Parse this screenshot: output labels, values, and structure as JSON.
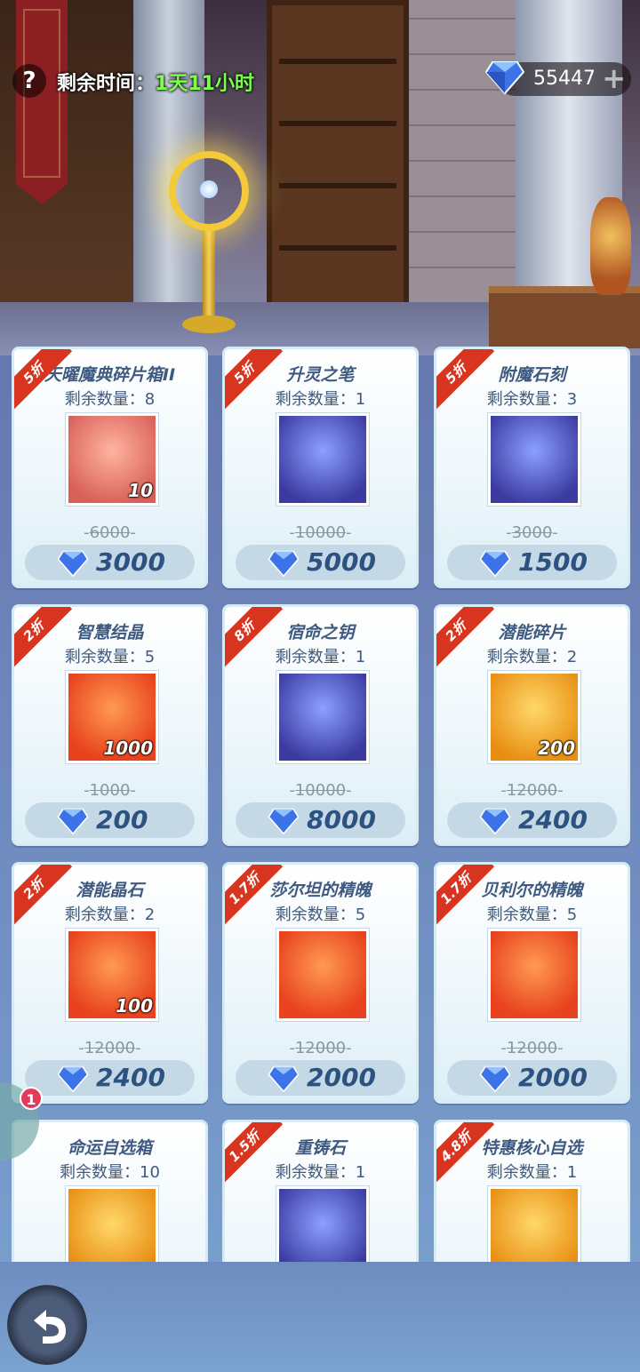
{
  "header": {
    "timer_label": "剩余时间：",
    "timer_value": "1天11小时",
    "currency_amount": "55447",
    "help_symbol": "?",
    "plus_symbol": "+"
  },
  "colors": {
    "ribbon": "#d83520",
    "timer_value": "#7cff4a",
    "text": "#3e5a80",
    "price": "#2b5280"
  },
  "items": [
    {
      "discount": "5折",
      "name": "天曜魔典碎片箱II",
      "remain": "剩余数量：8",
      "qty": "10",
      "old": "6000",
      "price": "3000",
      "icon": "crystal-box-icon"
    },
    {
      "discount": "5折",
      "name": "升灵之笔",
      "remain": "剩余数量：1",
      "qty": "",
      "old": "10000",
      "price": "5000",
      "icon": "feather-pen-icon"
    },
    {
      "discount": "5折",
      "name": "附魔石刻",
      "remain": "剩余数量：3",
      "qty": "",
      "old": "3000",
      "price": "1500",
      "icon": "rune-stone-icon"
    },
    {
      "discount": "2折",
      "name": "智慧结晶",
      "remain": "剩余数量：5",
      "qty": "1000",
      "old": "1000",
      "price": "200",
      "icon": "wisdom-crystal-icon"
    },
    {
      "discount": "8折",
      "name": "宿命之钥",
      "remain": "剩余数量：1",
      "qty": "",
      "old": "10000",
      "price": "8000",
      "icon": "key-icon"
    },
    {
      "discount": "2折",
      "name": "潜能碎片",
      "remain": "剩余数量：2",
      "qty": "200",
      "old": "12000",
      "price": "2400",
      "icon": "crystal-shard-icon"
    },
    {
      "discount": "2折",
      "name": "潜能晶石",
      "remain": "剩余数量：2",
      "qty": "100",
      "old": "12000",
      "price": "2400",
      "icon": "star-crystal-icon"
    },
    {
      "discount": "1.7折",
      "name": "莎尔坦的精魄",
      "remain": "剩余数量：5",
      "qty": "",
      "old": "12000",
      "price": "2000",
      "icon": "purple-orb-icon"
    },
    {
      "discount": "1.7折",
      "name": "贝利尔的精魄",
      "remain": "剩余数量：5",
      "qty": "",
      "old": "12000",
      "price": "2000",
      "icon": "red-orb-icon"
    },
    {
      "discount": "",
      "name": "命运自选箱",
      "remain": "剩余数量：10",
      "qty": "",
      "old": "",
      "price": "",
      "icon": "chest-icon"
    },
    {
      "discount": "1.5折",
      "name": "重铸石",
      "remain": "剩余数量：1",
      "qty": "",
      "old": "",
      "price": "",
      "icon": "reforge-stone-icon"
    },
    {
      "discount": "4.8折",
      "name": "特惠核心自选",
      "remain": "剩余数量：1",
      "qty": "",
      "old": "",
      "price": "",
      "icon": "core-card-icon"
    }
  ],
  "side_badge": {
    "count": "1"
  },
  "back_button": {
    "icon": "back-arrow-icon"
  }
}
